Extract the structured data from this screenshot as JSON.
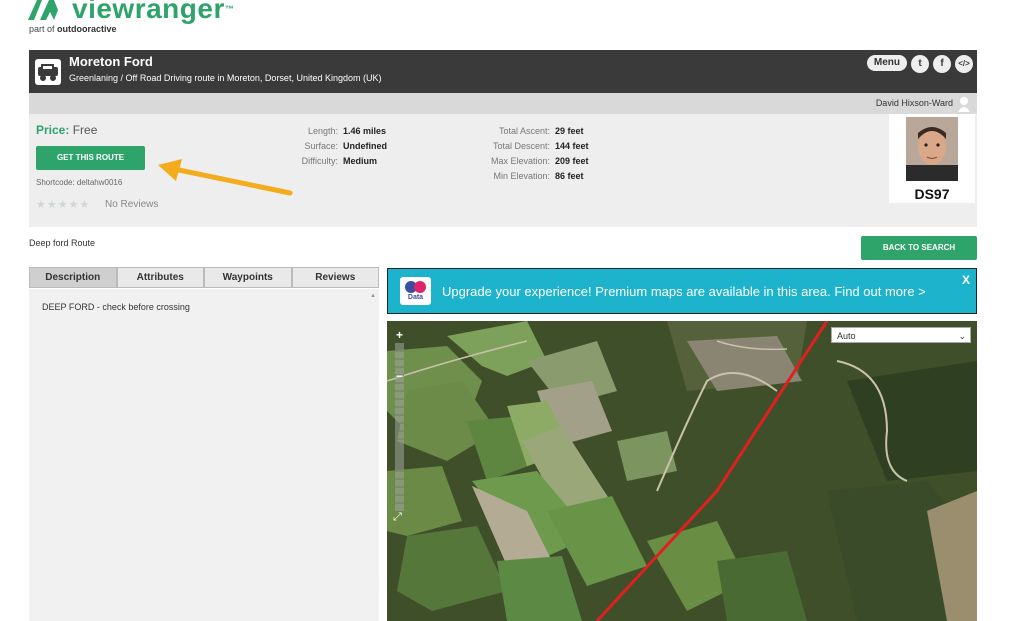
{
  "brand": {
    "name": "viewranger",
    "tm": "™",
    "part_of_prefix": "part of",
    "part_of_name": "outdooractive",
    "color": "#2ea46b"
  },
  "header": {
    "title": "Moreton Ford",
    "subtitle": "Greenlaning / Off Road Driving route in Moreton, Dorset, United Kingdom (UK)",
    "menu_label": "Menu",
    "icons": [
      "twitter-icon",
      "facebook-icon",
      "embed-icon"
    ],
    "twitter_glyph": "t",
    "facebook_glyph": "f",
    "embed_glyph": "</>"
  },
  "user": {
    "name": "David Hixson-Ward"
  },
  "info": {
    "price_label": "Price:",
    "price_value": "Free",
    "get_route": "GET THIS ROUTE",
    "shortcode": "Shortcode: deltahw0016",
    "stars": "★★★★★",
    "no_reviews": "No Reviews",
    "stats_left": [
      {
        "label": "Length:",
        "value": "1.46 miles"
      },
      {
        "label": "Surface:",
        "value": "Undefined"
      },
      {
        "label": "Difficulty:",
        "value": "Medium"
      }
    ],
    "stats_right": [
      {
        "label": "Total Ascent:",
        "value": "29 feet"
      },
      {
        "label": "Total Descent:",
        "value": "144 feet"
      },
      {
        "label": "Max Elevation:",
        "value": "209 feet"
      },
      {
        "label": "Min Elevation:",
        "value": "86 feet"
      }
    ],
    "author_code": "DS97"
  },
  "route_name": "Deep ford Route",
  "back_to_search": "BACK TO SEARCH",
  "tabs": [
    {
      "label": "Description",
      "active": true
    },
    {
      "label": "Attributes",
      "active": false
    },
    {
      "label": "Waypoints",
      "active": false
    },
    {
      "label": "Reviews",
      "active": false
    }
  ],
  "description": "DEEP FORD - check before crossing",
  "banner": {
    "logo_text": "Data",
    "text": "Upgrade your experience! Premium maps are available in this area. Find out more >",
    "close": "X"
  },
  "map": {
    "layer_selected": "Auto",
    "zoom_in": "+",
    "zoom_out": "−",
    "route_color": "#e02020"
  }
}
